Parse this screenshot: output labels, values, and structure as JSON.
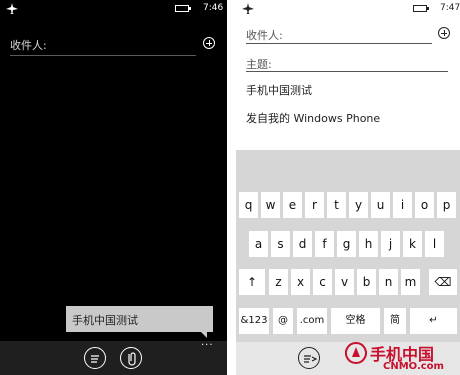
{
  "left": {
    "status": {
      "time": "7:46",
      "icons": [
        "airplane-icon",
        "battery-icon"
      ]
    },
    "to_label": "收件人:",
    "suggestion": "手机中国测试",
    "appbar": {
      "icons": [
        "send-icon",
        "attach-icon"
      ],
      "more": "..."
    }
  },
  "right": {
    "status": {
      "time": "7:47",
      "icons": [
        "airplane-icon",
        "battery-icon"
      ]
    },
    "to_label": "收件人:",
    "subject_label": "主题:",
    "body_line1": "手机中国测试",
    "body_line2": "发自我的 Windows Phone",
    "keyboard": {
      "row1": [
        "q",
        "w",
        "e",
        "r",
        "t",
        "y",
        "u",
        "i",
        "o",
        "p"
      ],
      "row2": [
        "a",
        "s",
        "d",
        "f",
        "g",
        "h",
        "j",
        "k",
        "l"
      ],
      "row3": [
        "↑",
        "z",
        "x",
        "c",
        "v",
        "b",
        "n",
        "m",
        "⌫"
      ],
      "row4": [
        "&123",
        "@",
        ".com",
        "空格",
        "简",
        "↵"
      ]
    },
    "appbar": {
      "icons": [
        "send-icon"
      ]
    }
  },
  "watermark": {
    "brand": "手机中国",
    "domain": "CNMO.com"
  },
  "colors": {
    "dark_bg": "#000000",
    "keyboard_bg": "#d6d6d6",
    "brand_red": "#c8102e"
  }
}
